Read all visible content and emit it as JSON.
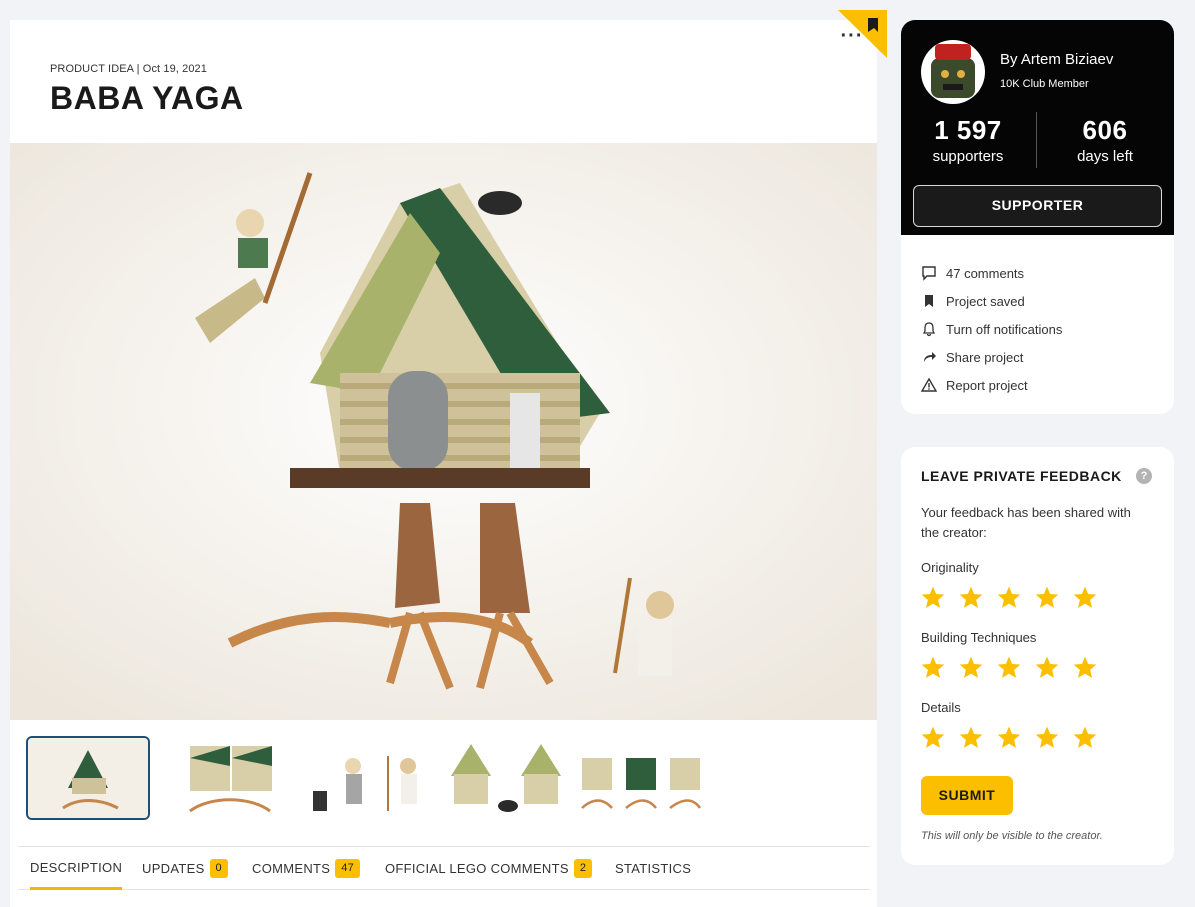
{
  "project": {
    "meta": "PRODUCT IDEA | Oct 19, 2021",
    "title": "BABA YAGA",
    "more_label": "···"
  },
  "thumbnails": [
    "thumbnail-1",
    "thumbnail-2",
    "thumbnail-3",
    "thumbnail-4",
    "thumbnail-5"
  ],
  "tabs": [
    {
      "label": "DESCRIPTION",
      "badge": null,
      "active": true
    },
    {
      "label": "UPDATES",
      "badge": "0"
    },
    {
      "label": "COMMENTS",
      "badge": "47"
    },
    {
      "label": "OFFICIAL LEGO COMMENTS",
      "badge": "2"
    },
    {
      "label": "STATISTICS",
      "badge": null
    }
  ],
  "creator": {
    "byline": "By Artem Biziaev",
    "club": "10K Club Member",
    "supporters_count": "1 597",
    "supporters_label": "supporters",
    "days_count": "606",
    "days_label": "days left",
    "support_button": "SUPPORTER"
  },
  "actions": {
    "comments": "47 comments",
    "saved": "Project saved",
    "notifications": "Turn off notifications",
    "share": "Share project",
    "report": "Report project"
  },
  "feedback": {
    "title": "LEAVE PRIVATE FEEDBACK",
    "help": "?",
    "message": "Your feedback has been shared with the creator:",
    "ratings": [
      {
        "label": "Originality",
        "stars": 5
      },
      {
        "label": "Building Techniques",
        "stars": 5
      },
      {
        "label": "Details",
        "stars": 5
      }
    ],
    "submit": "SUBMIT",
    "note": "This will only be visible to the creator."
  },
  "colors": {
    "accent": "#fbbf00",
    "page_bg": "#f2f3f7",
    "card_dark": "#050505",
    "thumb_active_border": "#1f4e79"
  }
}
